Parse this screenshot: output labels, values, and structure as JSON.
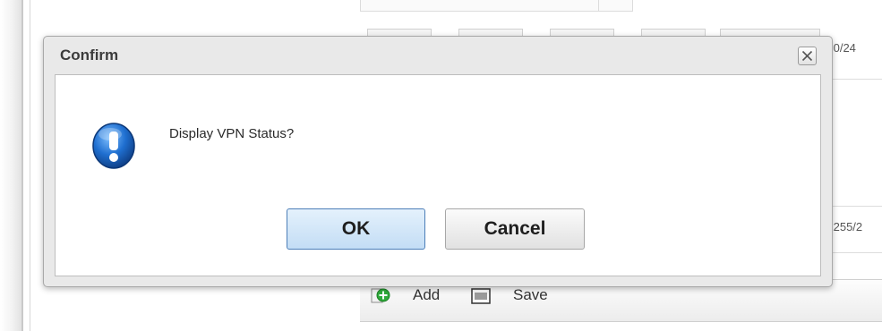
{
  "dialog": {
    "title": "Confirm",
    "message": "Display VPN Status?",
    "ok_label": "OK",
    "cancel_label": "Cancel",
    "close_icon": "close-icon",
    "message_icon": "exclamation-icon"
  },
  "background": {
    "row1_fragment": ".0/24",
    "row2_fragment": ".255/2",
    "toolbar": {
      "add_label": "Add",
      "save_label": "Save",
      "add_icon": "add-icon",
      "save_icon": "save-icon"
    }
  },
  "colors": {
    "ok_button_border": "#4d7fb8",
    "icon_blue": "#1f6fd0"
  }
}
